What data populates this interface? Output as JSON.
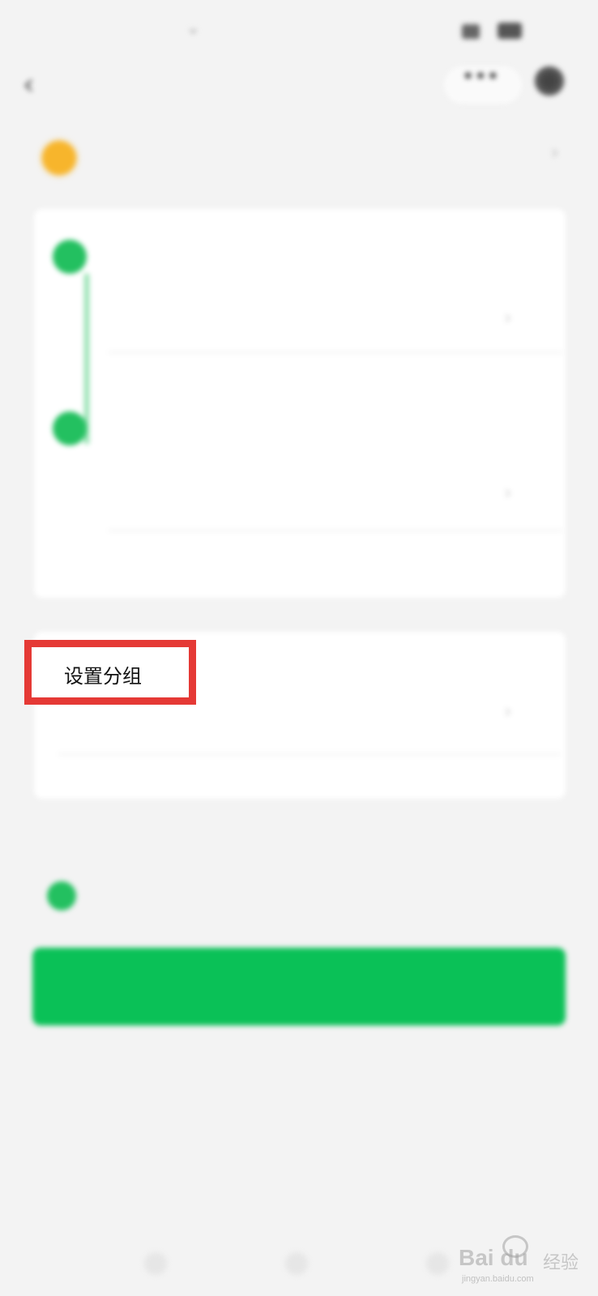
{
  "status_bar": {
    "time": "",
    "right": ""
  },
  "nav": {
    "title": "",
    "more_icon": "more-icon"
  },
  "category": {
    "label": "",
    "region": ""
  },
  "form": {
    "field1_label": "",
    "field1_value": "",
    "field2_label": "",
    "field2_value": "",
    "group_value": ""
  },
  "agreement": {
    "text": "",
    "link": ""
  },
  "primary_button": {
    "label": ""
  },
  "annotation": {
    "label": "设置分组",
    "color": "#e53935"
  },
  "colors": {
    "accent": "#0ac157",
    "background": "#f3f3f3"
  },
  "watermark": {
    "brand": "Bai du",
    "cn": "经验",
    "url": "jingyan.baidu.com"
  }
}
